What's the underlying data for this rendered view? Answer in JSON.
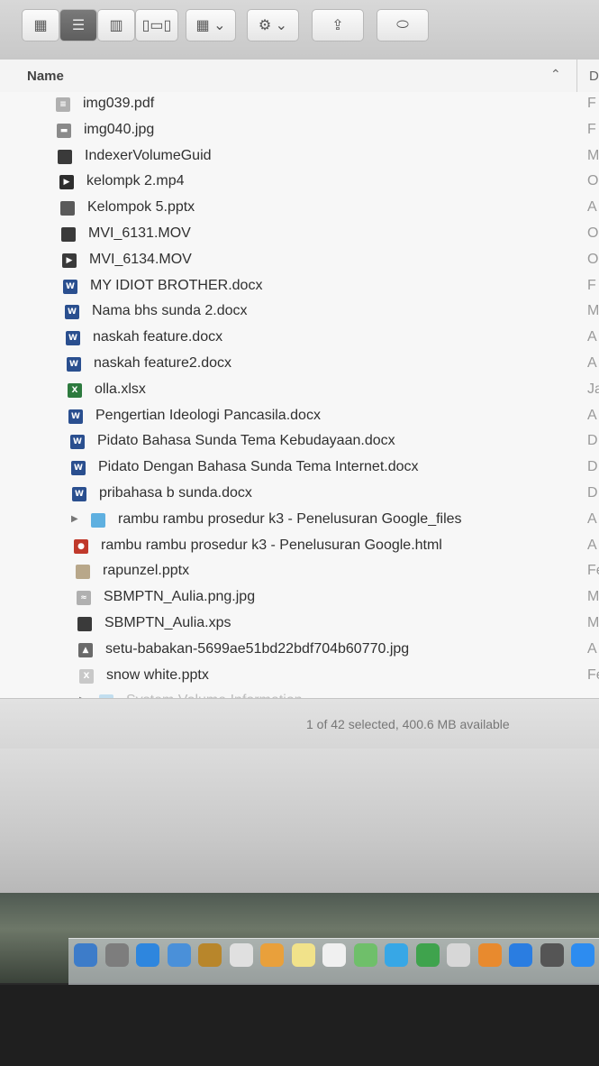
{
  "toolbar": {
    "icon_view": "icon-view",
    "list_view": "list-view",
    "column_view": "column-view",
    "coverflow_view": "coverflow-view",
    "arrange": "arrange-menu",
    "action": "gear-menu",
    "share": "share",
    "tags": "tags"
  },
  "header": {
    "name_label": "Name",
    "second_column_label": "D"
  },
  "files": [
    {
      "name": "img039.pdf",
      "icon": "pdf-icon",
      "color": "#b0b0b0",
      "glyph": "≡",
      "date": "F"
    },
    {
      "name": "img040.jpg",
      "icon": "image-icon",
      "color": "#8a8a8a",
      "glyph": "▬",
      "date": "F"
    },
    {
      "name": "IndexerVolumeGuid",
      "icon": "document-icon",
      "color": "#3a3a3a",
      "glyph": "",
      "date": "M"
    },
    {
      "name": "kelompk 2.mp4",
      "icon": "video-icon",
      "color": "#2e2e2e",
      "glyph": "▶",
      "date": "O"
    },
    {
      "name": "Kelompok 5.pptx",
      "icon": "presentation-icon",
      "color": "#5a5a5a",
      "glyph": "",
      "date": "A"
    },
    {
      "name": "MVI_6131.MOV",
      "icon": "video-icon",
      "color": "#3a3a3a",
      "glyph": "",
      "date": "O"
    },
    {
      "name": "MVI_6134.MOV",
      "icon": "video-icon",
      "color": "#3a3a3a",
      "glyph": "▶",
      "date": "O"
    },
    {
      "name": "MY IDIOT BROTHER.docx",
      "icon": "word-icon",
      "color": "#2a4f8f",
      "glyph": "W",
      "date": "F"
    },
    {
      "name": "Nama bhs sunda 2.docx",
      "icon": "word-icon",
      "color": "#2a4f8f",
      "glyph": "W",
      "date": "M"
    },
    {
      "name": "naskah feature.docx",
      "icon": "word-icon",
      "color": "#2a4f8f",
      "glyph": "W",
      "date": "A"
    },
    {
      "name": "naskah feature2.docx",
      "icon": "word-icon",
      "color": "#2a4f8f",
      "glyph": "W",
      "date": "A"
    },
    {
      "name": "olla.xlsx",
      "icon": "excel-icon",
      "color": "#2d7a3e",
      "glyph": "X",
      "date": "Ja"
    },
    {
      "name": "Pengertian Ideologi Pancasila.docx",
      "icon": "word-icon",
      "color": "#2a4f8f",
      "glyph": "W",
      "date": "A"
    },
    {
      "name": "Pidato Bahasa Sunda Tema Kebudayaan.docx",
      "icon": "word-icon",
      "color": "#2a4f8f",
      "glyph": "W",
      "date": "D"
    },
    {
      "name": "Pidato Dengan Bahasa Sunda Tema Internet.docx",
      "icon": "word-icon",
      "color": "#2a4f8f",
      "glyph": "W",
      "date": "D"
    },
    {
      "name": "pribahasa b sunda.docx",
      "icon": "word-icon",
      "color": "#2a4f8f",
      "glyph": "W",
      "date": "D"
    },
    {
      "name": "rambu rambu prosedur k3 - Penelusuran Google_files",
      "icon": "folder-icon",
      "color": "#5fb0e0",
      "glyph": "",
      "date": "A",
      "folder": true
    },
    {
      "name": "rambu rambu prosedur k3 - Penelusuran Google.html",
      "icon": "html-icon",
      "color": "#c0392b",
      "glyph": "●",
      "date": "A"
    },
    {
      "name": "rapunzel.pptx",
      "icon": "presentation-icon",
      "color": "#b8a78a",
      "glyph": "",
      "date": "Fe"
    },
    {
      "name": "SBMPTN_Aulia.png.jpg",
      "icon": "image-icon",
      "color": "#b0b0b0",
      "glyph": "≈",
      "date": "M"
    },
    {
      "name": "SBMPTN_Aulia.xps",
      "icon": "document-icon",
      "color": "#3a3a3a",
      "glyph": "",
      "date": "M"
    },
    {
      "name": "setu-babakan-5699ae51bd22bdf704b60770.jpg",
      "icon": "image-icon",
      "color": "#6a6a6a",
      "glyph": "▲",
      "date": "A"
    },
    {
      "name": "snow white.pptx",
      "icon": "presentation-icon",
      "color": "#c8c8c8",
      "glyph": "X",
      "date": "Fe"
    },
    {
      "name": "System Volume Information",
      "icon": "folder-icon",
      "color": "#5fb0e0",
      "glyph": "",
      "date": "",
      "folder": true,
      "faded": true
    }
  ],
  "status": {
    "text": "1 of 42 selected, 400.6 MB available"
  },
  "dock": [
    {
      "name": "finder-icon",
      "color": "#3d7cc9"
    },
    {
      "name": "launchpad-icon",
      "color": "#7d7d7d"
    },
    {
      "name": "safari-icon",
      "color": "#2e86de"
    },
    {
      "name": "mail-icon",
      "color": "#4a90d9"
    },
    {
      "name": "contacts-icon",
      "color": "#b8862b"
    },
    {
      "name": "calendar-icon",
      "color": "#e0e0e0"
    },
    {
      "name": "photos-icon",
      "color": "#e9a03b"
    },
    {
      "name": "notes-icon",
      "color": "#f1e28a"
    },
    {
      "name": "reminders-icon",
      "color": "#f0f0f0"
    },
    {
      "name": "maps-icon",
      "color": "#6fbf6a"
    },
    {
      "name": "messages-icon",
      "color": "#37a7e6"
    },
    {
      "name": "facetime-icon",
      "color": "#3fa34d"
    },
    {
      "name": "itunes-icon",
      "color": "#d7d7d7"
    },
    {
      "name": "ibooks-icon",
      "color": "#e88a2e"
    },
    {
      "name": "app-store-icon",
      "color": "#2a7de1"
    },
    {
      "name": "system-preferences-icon",
      "color": "#555555"
    },
    {
      "name": "chrome-icon",
      "color": "#2d8cf0"
    }
  ]
}
